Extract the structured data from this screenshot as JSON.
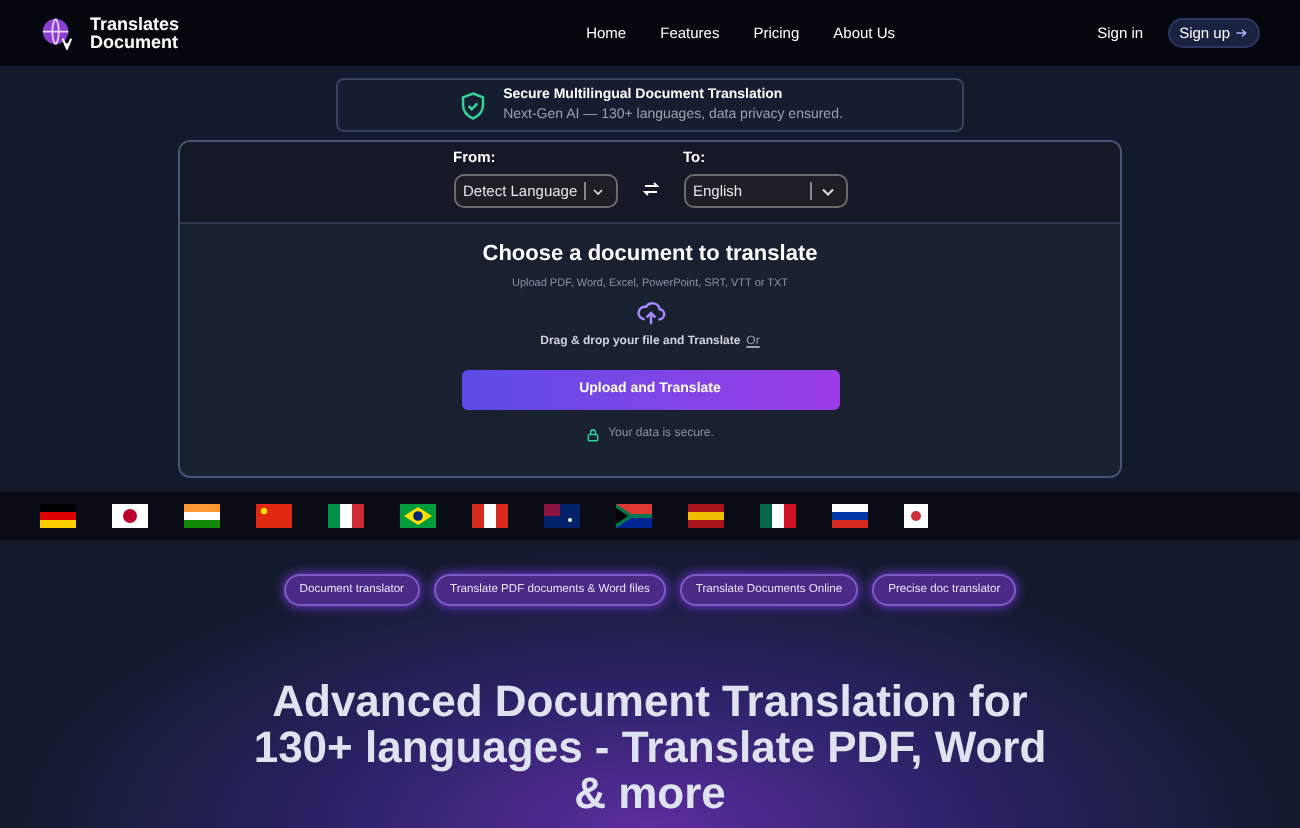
{
  "brand": {
    "line1": "Translates",
    "line2": "Document"
  },
  "nav": [
    {
      "label": "Home"
    },
    {
      "label": "Features"
    },
    {
      "label": "Pricing"
    },
    {
      "label": "About Us"
    }
  ],
  "auth": {
    "sign_in": "Sign in",
    "sign_up": "Sign up"
  },
  "banner": {
    "title": "Secure Multilingual Document Translation",
    "subtitle": "Next-Gen AI — 130+ languages, data privacy ensured."
  },
  "translator": {
    "from_label": "From:",
    "from_value": "Detect Language",
    "to_label": "To:",
    "to_value": "English",
    "heading": "Choose a document to translate",
    "formats": "Upload PDF, Word, Excel, PowerPoint, SRT, VTT or TXT",
    "drop_text": "Drag & drop your file and Translate",
    "drop_link": "Or",
    "button": "Upload and Translate",
    "secure_note": "Your data is secure."
  },
  "tags": [
    "Document translator",
    "Translate PDF documents & Word files",
    "Translate Documents Online",
    "Precise doc translator"
  ],
  "headline": "Advanced Document Translation for 130+ languages - Translate PDF, Word & more"
}
